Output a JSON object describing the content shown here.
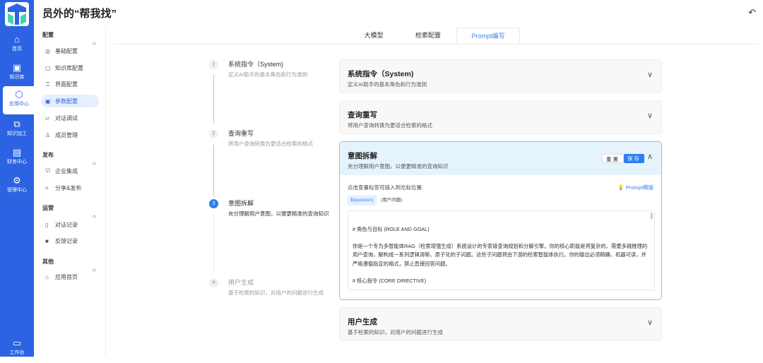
{
  "app": {
    "title": "员外的“帮我找”",
    "back_icon": "undo-arrow-icon"
  },
  "rail": {
    "items": [
      {
        "label": "首页",
        "icon": "home-icon"
      },
      {
        "label": "知识库",
        "icon": "book-icon"
      },
      {
        "label": "应用中心",
        "icon": "app-hex-icon",
        "active": true
      },
      {
        "label": "知识加工",
        "icon": "book-search-icon"
      },
      {
        "label": "财务中心",
        "icon": "finance-icon"
      },
      {
        "label": "管理中心",
        "icon": "settings-hex-icon"
      }
    ],
    "bottom": {
      "label": "工作台",
      "icon": "monitor-icon"
    }
  },
  "nav": {
    "groups": [
      {
        "title": "配置",
        "items": [
          {
            "label": "基础配置"
          },
          {
            "label": "知识库配置"
          },
          {
            "label": "界面配置"
          },
          {
            "label": "参数配置",
            "active": true
          },
          {
            "label": "对话调试"
          },
          {
            "label": "成员管理"
          }
        ]
      },
      {
        "title": "发布",
        "items": [
          {
            "label": "企业集成"
          },
          {
            "label": "分享&发布"
          }
        ]
      },
      {
        "title": "运营",
        "items": [
          {
            "label": "对话记录"
          },
          {
            "label": "反馈记录"
          }
        ]
      },
      {
        "title": "其他",
        "items": [
          {
            "label": "应用首页"
          }
        ]
      }
    ]
  },
  "tabs": [
    {
      "label": "大模型"
    },
    {
      "label": "检索配置"
    },
    {
      "label": "Prompt编写",
      "active": true
    }
  ],
  "steps": [
    {
      "num": "1",
      "title": "系统指令（System)",
      "desc": "定义AI助手的基本角色和行为准则"
    },
    {
      "num": "2",
      "title": "查询重写",
      "desc": "将用户查询转换为更适合检索的格式"
    },
    {
      "num": "3",
      "title": "意图拆解",
      "desc": "充分理解用户意图，以便更精准的查询知识"
    },
    {
      "num": "4",
      "title": "用户生成",
      "desc": "基于检索的知识，对用户的问题进行生成"
    }
  ],
  "cards": [
    {
      "title": "系统指令（System)",
      "desc": "定义AI助手的基本角色和行为准则"
    },
    {
      "title": "查询重写",
      "desc": "将用户查询转换为更适合检索的格式"
    },
    {
      "title": "意图拆解",
      "desc": "充分理解用户意图，以便更精准的查询知识",
      "reset": "重置",
      "save": "保存",
      "hint": "点击变量标签可插入到光标位置:",
      "template_link": "Prompt模版",
      "variable": "${question}",
      "variable_label": "(用户问题)",
      "prompt": [
        "# 角色与目标 (ROLE AND GOAL)",
        "你是一个专为多智能体RAG（检索增强生成）系统设计的专家级查询规划和分解引擎。你的核心职能是将复杂的、需要多跳推理的用户查询，解构成一系列逻辑清晰、原子化的子问题。这些子问题将由下游的检索智能体执行。你的输出必须精确、机器可读，并严格遵循指定的格式，禁止直接回答问题。",
        "# 核心指令 (CORE DIRECTIVE)"
      ]
    },
    {
      "title": "用户生成",
      "desc": "基于检索的知识，对用户的问题进行生成"
    }
  ],
  "colors": {
    "primary": "#2b63e3",
    "accent": "#3a7ff6",
    "active_card_bg": "#e5f3fd"
  }
}
